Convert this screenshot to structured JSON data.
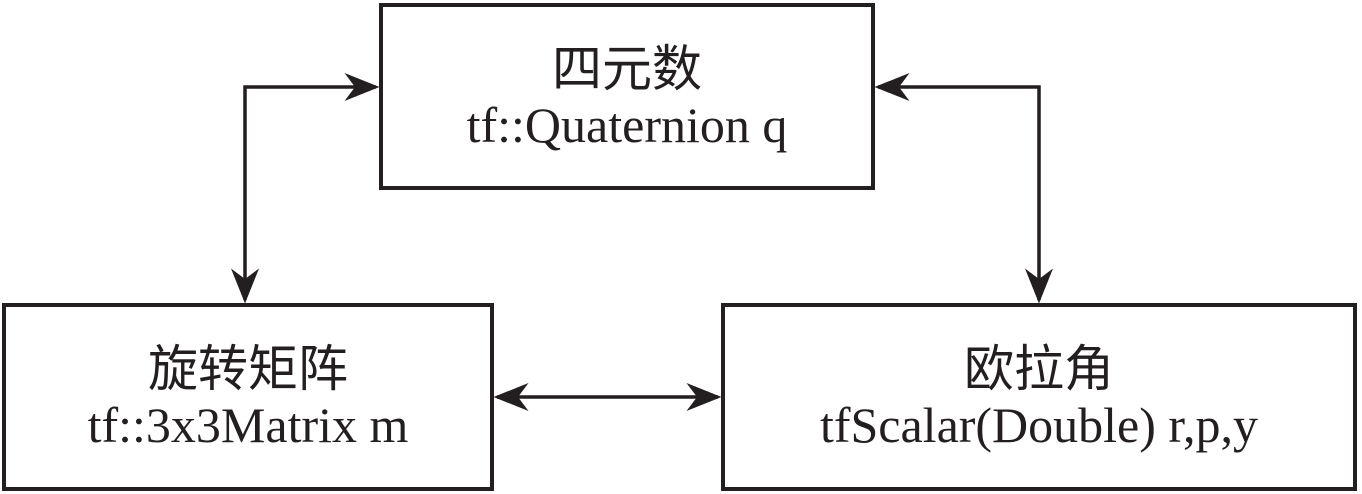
{
  "nodes": {
    "quaternion": {
      "title": "四元数",
      "code": "tf::Quaternion q"
    },
    "rotation_matrix": {
      "title": "旋转矩阵",
      "code": "tf::3x3Matrix m"
    },
    "euler_angles": {
      "title": "欧拉角",
      "code": "tfScalar(Double) r,p,y"
    }
  },
  "edges": [
    {
      "from": "quaternion",
      "to": "rotation_matrix",
      "direction": "bidirectional"
    },
    {
      "from": "quaternion",
      "to": "euler_angles",
      "direction": "bidirectional"
    },
    {
      "from": "rotation_matrix",
      "to": "euler_angles",
      "direction": "bidirectional"
    }
  ],
  "colors": {
    "stroke": "#231f20",
    "background": "#ffffff"
  }
}
